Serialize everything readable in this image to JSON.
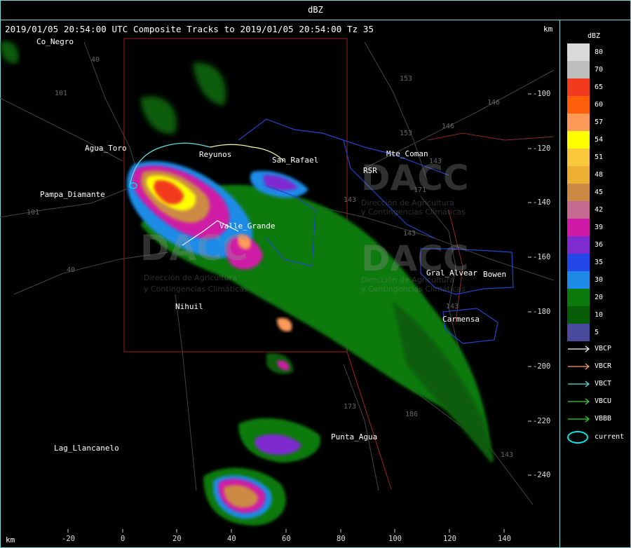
{
  "window": {
    "title": "dBZ"
  },
  "header": {
    "caption": "2019/01/05 20:54:00 UTC Composite Tracks to 2019/01/05 20:54:00 Tz 35",
    "km_label_top": "km",
    "km_label_bottom": "km"
  },
  "axes": {
    "y_ticks": [
      "-100",
      "-120",
      "-140",
      "-160",
      "-180",
      "-200",
      "-220",
      "-240"
    ],
    "x_ticks": [
      "-20",
      "0",
      "20",
      "40",
      "60",
      "80",
      "100",
      "120",
      "140"
    ]
  },
  "places": {
    "co_negro": "Co_Negro",
    "agua_toro": "Agua_Toro",
    "pampa_diamante": "Pampa_Diamante",
    "reyunos": "Reyunos",
    "san_rafael": "San_Rafael",
    "mte_coman": "Mte_Coman",
    "rsr": "RSR",
    "valle_grande": "Valle_Grande",
    "gral_alvear": "Gral_Alvear",
    "bowen": "Bowen",
    "carmensa": "Carmensa",
    "nihuil": "Nihuil",
    "punta_agua": "Punta_Agua",
    "lag_llancanelo": "Lag_Llancanelo"
  },
  "road_numbers": {
    "r40_north": "40",
    "r101_west": "101",
    "r101_sw": "101",
    "r40_west": "40",
    "r153_a": "153",
    "r153_b": "153",
    "r146_a": "146",
    "r146_b": "146",
    "r143_a": "143",
    "r143_b": "143",
    "r143_c": "143",
    "r171": "171",
    "r173": "173",
    "r143_d": "143",
    "r143_e": "143",
    "r186": "186"
  },
  "watermark": {
    "brand": "DACC",
    "line1": "Dirección de Agricultura",
    "line2": "y Contingencias Climáticas"
  },
  "legend": {
    "units": "dBZ",
    "scale": [
      {
        "label": "80",
        "color": "#d9d9d9"
      },
      {
        "label": "70",
        "color": "#bdbdbd"
      },
      {
        "label": "65",
        "color": "#f23a1e"
      },
      {
        "label": "60",
        "color": "#fc5e0a"
      },
      {
        "label": "57",
        "color": "#fd9a5a"
      },
      {
        "label": "54",
        "color": "#ffff00"
      },
      {
        "label": "51",
        "color": "#f8c83a"
      },
      {
        "label": "48",
        "color": "#eeb032"
      },
      {
        "label": "45",
        "color": "#cc8a44"
      },
      {
        "label": "42",
        "color": "#c46a90"
      },
      {
        "label": "39",
        "color": "#cf1aa6"
      },
      {
        "label": "36",
        "color": "#7e2cd0"
      },
      {
        "label": "35",
        "color": "#2248ea"
      },
      {
        "label": "30",
        "color": "#1e8ce6"
      },
      {
        "label": "20",
        "color": "#0d7a0d"
      },
      {
        "label": "10",
        "color": "#075d07"
      },
      {
        "label": "5",
        "color": "#4a4a9c"
      }
    ],
    "tracks": [
      {
        "label": "VBCP",
        "color": "#ffffff"
      },
      {
        "label": "VBCR",
        "color": "#f0a070"
      },
      {
        "label": "VBCT",
        "color": "#66dddd"
      },
      {
        "label": "VBCU",
        "color": "#44cc44"
      },
      {
        "label": "VBBB",
        "color": "#22dd22"
      }
    ],
    "current_label": "current",
    "current_color": "#00e5e5"
  }
}
